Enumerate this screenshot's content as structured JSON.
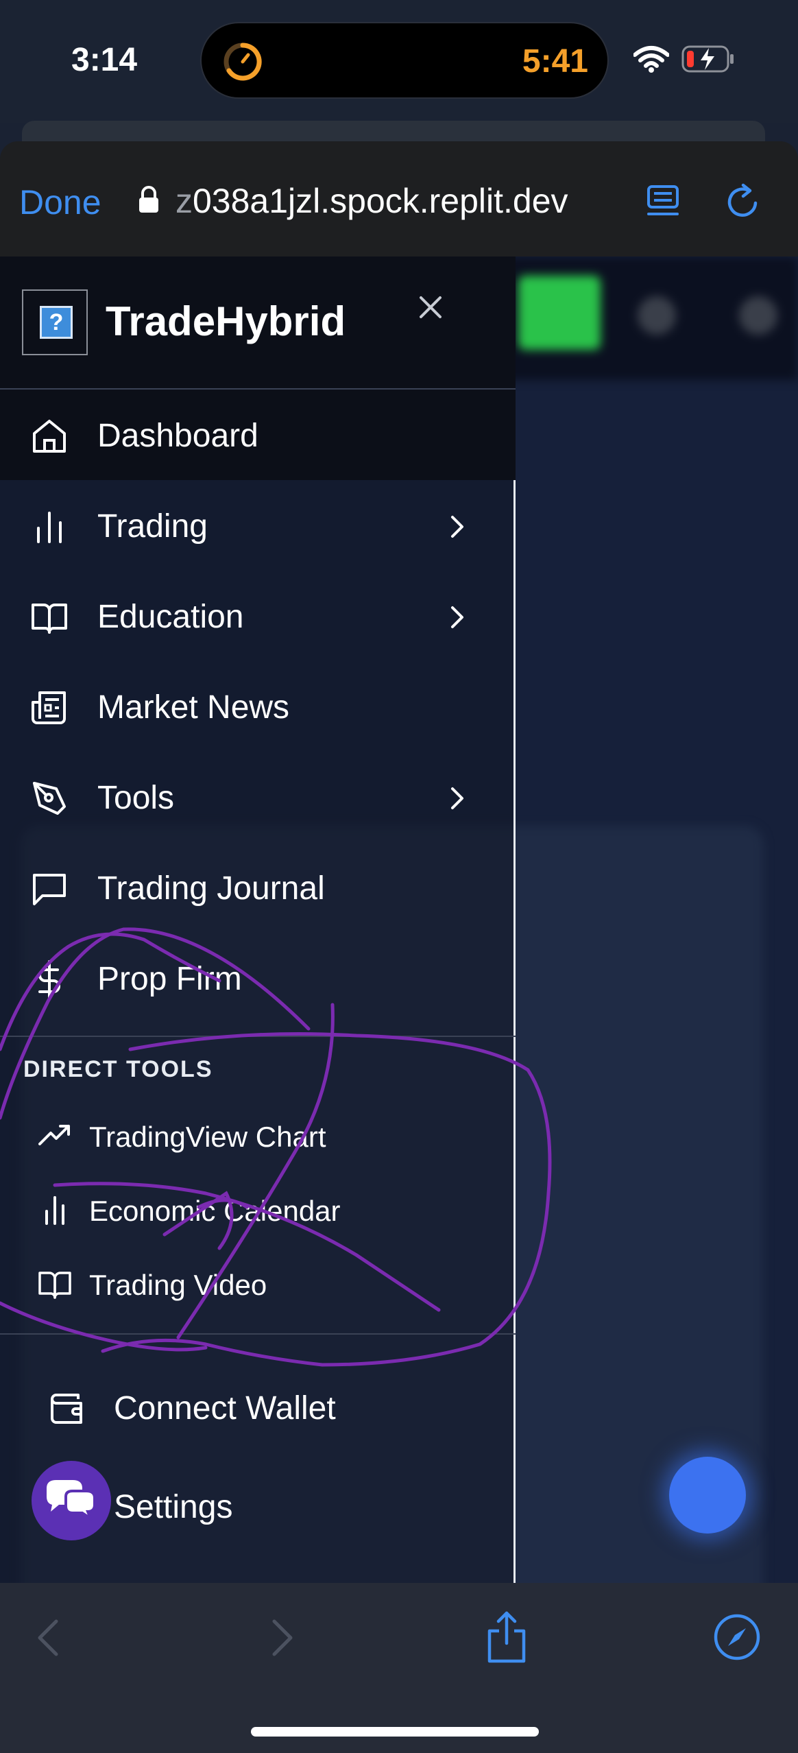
{
  "status_bar": {
    "time": "3:14",
    "timer_time": "5:41",
    "timer_color": "#f5a02a"
  },
  "browser": {
    "done_label": "Done",
    "url_prefix": "z",
    "url_rest": "038a1jzl.spock.replit.dev",
    "accent_color": "#3f8ef0"
  },
  "drawer": {
    "brand": "TradeHybrid",
    "logo_glyph": "?",
    "close_glyph": "×",
    "nav_items": [
      {
        "label": "Dashboard",
        "icon": "home-icon",
        "has_submenu": false,
        "active": true
      },
      {
        "label": "Trading",
        "icon": "bar-chart-icon",
        "has_submenu": true,
        "active": false
      },
      {
        "label": "Education",
        "icon": "book-open-icon",
        "has_submenu": true,
        "active": false
      },
      {
        "label": "Market News",
        "icon": "newspaper-icon",
        "has_submenu": false,
        "active": false
      },
      {
        "label": "Tools",
        "icon": "pen-tool-icon",
        "has_submenu": true,
        "active": false
      },
      {
        "label": "Trading Journal",
        "icon": "message-square-icon",
        "has_submenu": false,
        "active": false
      },
      {
        "label": "Prop Firm",
        "icon": "dollar-icon",
        "has_submenu": false,
        "active": false
      }
    ],
    "direct_tools_title": "DIRECT TOOLS",
    "direct_tools": [
      {
        "label": "TradingView Chart",
        "icon": "trending-up-icon"
      },
      {
        "label": "Economic Calendar",
        "icon": "bar-chart-icon"
      },
      {
        "label": "Trading Video",
        "icon": "book-open-icon"
      }
    ],
    "bottom_items": [
      {
        "label": "Connect Wallet",
        "icon": "wallet-icon"
      },
      {
        "label": "Settings",
        "icon": "settings-icon"
      }
    ]
  },
  "colors": {
    "scribble": "#7b2bb0",
    "chat_fab": "#5b30b4",
    "blue_fab": "#3c72f0"
  }
}
